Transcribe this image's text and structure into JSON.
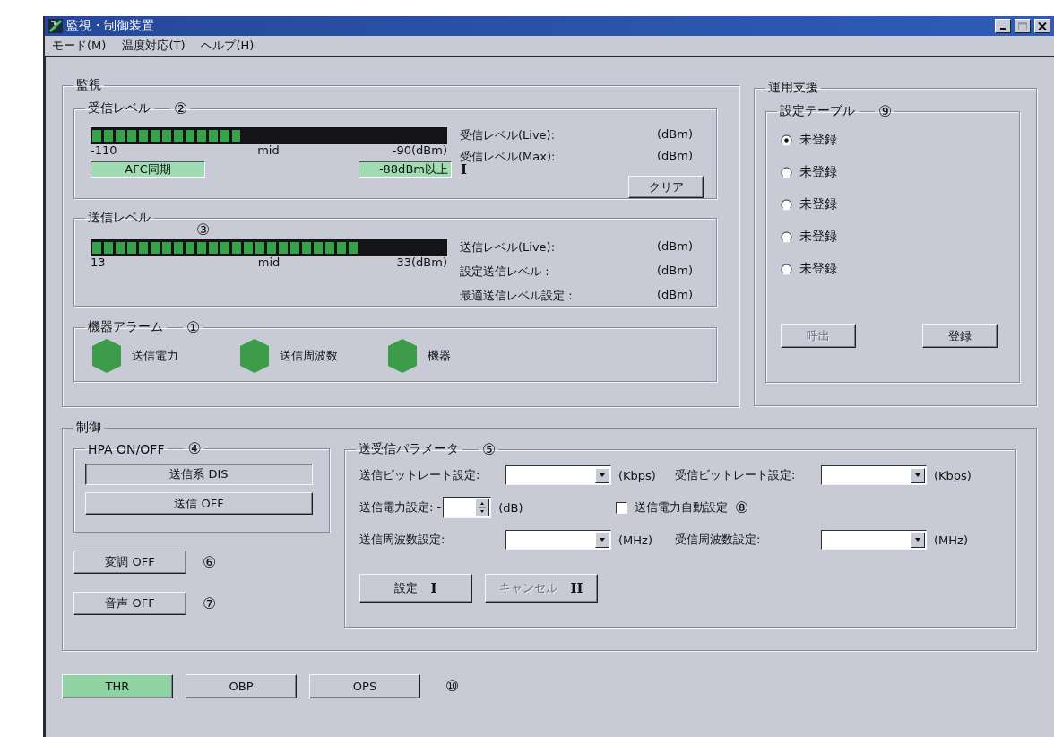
{
  "window": {
    "title": "監視・制御装置"
  },
  "menu": [
    {
      "label": "モード(M)"
    },
    {
      "label": "温度対応(T)"
    },
    {
      "label": "ヘルプ(H)"
    }
  ],
  "monitor": {
    "title": "監視",
    "rx_level": {
      "title": "受信レベル",
      "marker": "②",
      "level": 0.42,
      "scale": [
        "-110",
        "mid",
        "-90(dBm)"
      ],
      "afc": "AFC同期",
      "threshold": "-88dBm以上",
      "threshold_marker": "I",
      "readings": [
        {
          "label": "受信レベル(Live):",
          "unit": "(dBm)"
        },
        {
          "label": "受信レベル(Max):",
          "unit": "(dBm)"
        }
      ],
      "clear_button": "クリア"
    },
    "tx_level": {
      "title": "送信レベル",
      "marker": "③",
      "level": 0.76,
      "scale": [
        "13",
        "mid",
        "33(dBm)"
      ],
      "readings": [
        {
          "label": "送信レベル(Live):",
          "unit": "(dBm)"
        },
        {
          "label": "設定送信レベル :",
          "unit": "(dBm)"
        },
        {
          "label": "最適送信レベル設定 :",
          "unit": "(dBm)"
        }
      ]
    },
    "alarms": {
      "title": "機器アラーム",
      "marker": "①",
      "items": [
        {
          "label": "送信電力",
          "color": "#3c9c4a"
        },
        {
          "label": "送信周波数",
          "color": "#3c9c4a"
        },
        {
          "label": "機器",
          "color": "#3c9c4a"
        }
      ]
    }
  },
  "support": {
    "title": "運用支援",
    "table": {
      "title": "設定テーブル",
      "marker": "⑨",
      "slots": [
        {
          "label": "未登録",
          "selected": true
        },
        {
          "label": "未登録",
          "selected": false
        },
        {
          "label": "未登録",
          "selected": false
        },
        {
          "label": "未登録",
          "selected": false
        },
        {
          "label": "未登録",
          "selected": false
        }
      ],
      "buttons": [
        {
          "label": "呼出",
          "disabled": true
        },
        {
          "label": "登録",
          "disabled": false
        }
      ]
    }
  },
  "control": {
    "title": "制御",
    "hpa": {
      "title": "HPA ON/OFF",
      "marker": "④",
      "status": "送信系 DIS",
      "button": "送信 OFF"
    },
    "toggles": [
      {
        "label": "変調 OFF",
        "marker": "⑥"
      },
      {
        "label": "音声 OFF",
        "marker": "⑦"
      }
    ],
    "params": {
      "title": "送受信パラメータ",
      "marker": "⑤",
      "rows": [
        {
          "items": [
            {
              "kind": "dropdown",
              "label": "送信ビットレート設定:",
              "unit": "(Kbps)"
            },
            {
              "kind": "dropdown",
              "label": "受信ビットレート設定:",
              "unit": "(Kbps)"
            }
          ]
        },
        {
          "items": [
            {
              "kind": "spinner",
              "label": "送信電力設定: -",
              "unit": "(dB)"
            },
            {
              "kind": "checkbox",
              "label": "送信電力自動設定",
              "checked": false,
              "marker": "⑧"
            }
          ]
        },
        {
          "items": [
            {
              "kind": "dropdown",
              "label": "送信周波数設定:",
              "unit": "(MHz)"
            },
            {
              "kind": "dropdown",
              "label": "受信周波数設定:",
              "unit": "(MHz)"
            }
          ]
        }
      ],
      "buttons": [
        {
          "label": "設定",
          "suffix": "I",
          "disabled": false
        },
        {
          "label": "キャンセル",
          "suffix": "II",
          "disabled": true
        }
      ]
    }
  },
  "modes": {
    "marker": "⑩",
    "buttons": [
      {
        "label": "THR",
        "selected": true
      },
      {
        "label": "OBP",
        "selected": false
      },
      {
        "label": "OPS",
        "selected": false
      }
    ]
  }
}
